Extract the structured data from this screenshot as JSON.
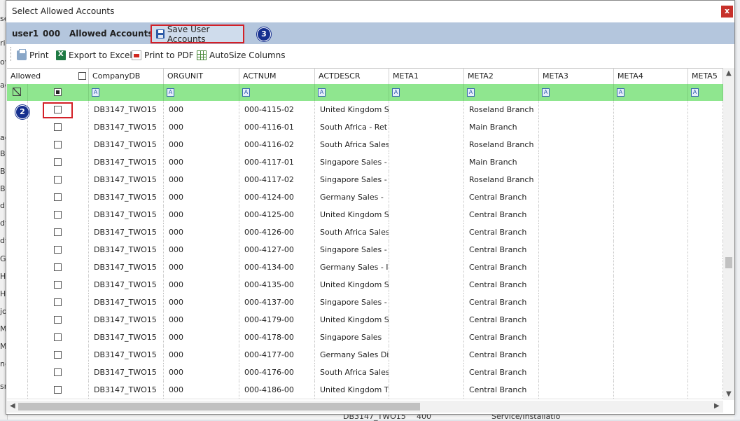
{
  "window": {
    "title": "Select Allowed Accounts",
    "close_label": "x"
  },
  "infobar": {
    "user": "user1",
    "org": "000",
    "allowed_label": "Allowed Accounts",
    "save_label": "Save User Accounts"
  },
  "badges": {
    "step2": "2",
    "step3": "3"
  },
  "toolbar": {
    "print": "Print",
    "export_excel": "Export to Excel",
    "print_pdf": "Print to PDF",
    "autosize": "AutoSize Columns"
  },
  "columns": [
    "Allowed",
    "CompanyDB",
    "ORGUNIT",
    "ACTNUM",
    "ACTDESCR",
    "META1",
    "META2",
    "META3",
    "META4",
    "META5"
  ],
  "rows": [
    {
      "company": "DB3147_TWO15",
      "org": "000",
      "actnum": "000-4115-02",
      "descr": "United Kingdom S",
      "meta2": "Roseland Branch"
    },
    {
      "company": "DB3147_TWO15",
      "org": "000",
      "actnum": "000-4116-01",
      "descr": "South Africa - Ret",
      "meta2": "Main Branch"
    },
    {
      "company": "DB3147_TWO15",
      "org": "000",
      "actnum": "000-4116-02",
      "descr": "South Africa Sales",
      "meta2": "Roseland Branch"
    },
    {
      "company": "DB3147_TWO15",
      "org": "000",
      "actnum": "000-4117-01",
      "descr": "Singapore Sales -",
      "meta2": "Main Branch"
    },
    {
      "company": "DB3147_TWO15",
      "org": "000",
      "actnum": "000-4117-02",
      "descr": "Singapore Sales -",
      "meta2": "Roseland Branch"
    },
    {
      "company": "DB3147_TWO15",
      "org": "000",
      "actnum": "000-4124-00",
      "descr": "Germany Sales -",
      "meta2": "Central Branch"
    },
    {
      "company": "DB3147_TWO15",
      "org": "000",
      "actnum": "000-4125-00",
      "descr": "United Kingdom S",
      "meta2": "Central Branch"
    },
    {
      "company": "DB3147_TWO15",
      "org": "000",
      "actnum": "000-4126-00",
      "descr": "South Africa Sales",
      "meta2": "Central Branch"
    },
    {
      "company": "DB3147_TWO15",
      "org": "000",
      "actnum": "000-4127-00",
      "descr": "Singapore Sales -",
      "meta2": "Central Branch"
    },
    {
      "company": "DB3147_TWO15",
      "org": "000",
      "actnum": "000-4134-00",
      "descr": "Germany Sales - I",
      "meta2": "Central Branch"
    },
    {
      "company": "DB3147_TWO15",
      "org": "000",
      "actnum": "000-4135-00",
      "descr": "United Kingdom S",
      "meta2": "Central Branch"
    },
    {
      "company": "DB3147_TWO15",
      "org": "000",
      "actnum": "000-4137-00",
      "descr": "Singapore Sales -",
      "meta2": "Central Branch"
    },
    {
      "company": "DB3147_TWO15",
      "org": "000",
      "actnum": "000-4179-00",
      "descr": "United Kingdom S",
      "meta2": "Central Branch"
    },
    {
      "company": "DB3147_TWO15",
      "org": "000",
      "actnum": "000-4178-00",
      "descr": "Singapore Sales",
      "meta2": "Central Branch"
    },
    {
      "company": "DB3147_TWO15",
      "org": "000",
      "actnum": "000-4177-00",
      "descr": "Germany Sales Di",
      "meta2": "Central Branch"
    },
    {
      "company": "DB3147_TWO15",
      "org": "000",
      "actnum": "000-4176-00",
      "descr": "South Africa Sales",
      "meta2": "Central Branch"
    },
    {
      "company": "DB3147_TWO15",
      "org": "000",
      "actnum": "000-4186-00",
      "descr": "United Kingdom T",
      "meta2": "Central Branch"
    }
  ],
  "background": {
    "left_fragments": [
      "se",
      "ri",
      "ov",
      "ac",
      "ag",
      "BI",
      "BI",
      "BI",
      "d",
      "dy",
      "dy",
      "G",
      "H",
      "H",
      "jo",
      "M",
      "M",
      "nc",
      "sr"
    ],
    "bottom_text": [
      "DB3147_TWO15",
      "400",
      "Service/Installatio"
    ]
  },
  "colors": {
    "infobar": "#b4c6dd",
    "filter_row": "#8fe68f",
    "highlight": "#d32027",
    "badge": "#16308f"
  }
}
